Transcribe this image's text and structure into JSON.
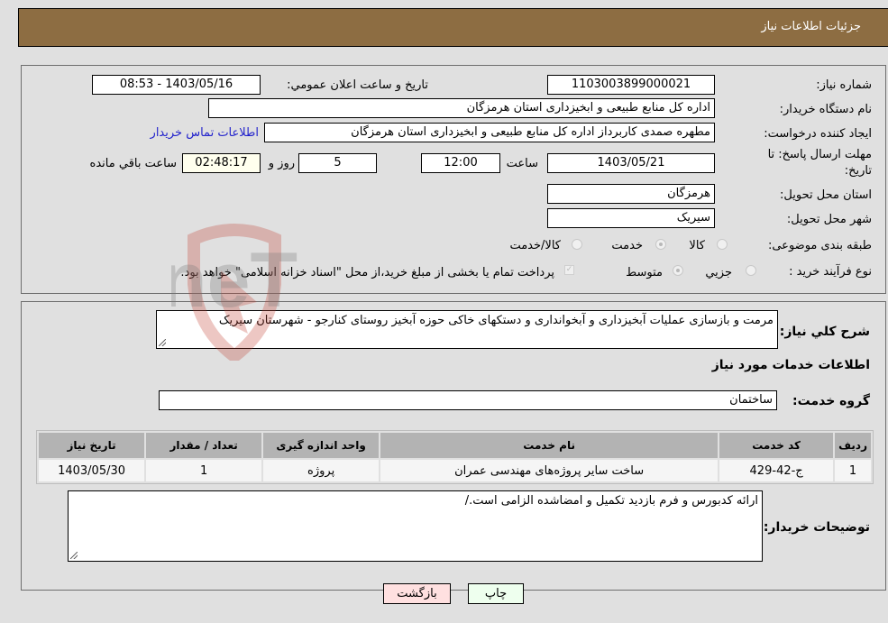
{
  "header": {
    "title": "جزئیات اطلاعات نیاز"
  },
  "form": {
    "need_number": {
      "label": "شماره نیاز:",
      "value": "1103003899000021"
    },
    "announce_datetime": {
      "label": "تاریخ و ساعت اعلان عمومي:",
      "value": "1403/05/16 - 08:53"
    },
    "buyer_org": {
      "label": "نام دستگاه خريدار:",
      "value": "اداره کل منابع طبیعی و ابخیزداری استان هرمزگان"
    },
    "requester": {
      "label": "ایجاد کننده درخواست:",
      "value": "مطهره صمدی کاربرداز اداره کل منابع طبیعی و ابخیزداری استان هرمزگان"
    },
    "buyer_contact_link": "اطلاعات تماس خریدار",
    "deadline": {
      "label_line1": "مهلت ارسال پاسخ: تا",
      "label_line2": "تاریخ:",
      "date": "1403/05/21",
      "time_label": "ساعت",
      "time": "12:00",
      "days": "5",
      "days_label": "روز و",
      "remaining": "02:48:17",
      "remaining_label": "ساعت باقي مانده"
    },
    "delivery_province": {
      "label": "استان محل تحویل:",
      "value": "هرمزگان"
    },
    "delivery_city": {
      "label": "شهر محل تحویل:",
      "value": "سیریک"
    },
    "category": {
      "label": "طبقه بندی موضوعی:",
      "options": [
        {
          "label": "کالا",
          "checked": false
        },
        {
          "label": "خدمت",
          "checked": true
        },
        {
          "label": "کالا/خدمت",
          "checked": false
        }
      ]
    },
    "purchase_type": {
      "label": "نوع فرآیند خرید :",
      "options": [
        {
          "label": "جزيي",
          "checked": false
        },
        {
          "label": "متوسط",
          "checked": true
        }
      ],
      "payment_note": "پرداخت تمام یا بخشی از مبلغ خرید،از محل \"اسناد خزانه اسلامی\" خواهد بود.",
      "payment_checked": true
    }
  },
  "details": {
    "description_label": "شرح کلي نياز:",
    "description": "مرمت و بازسازی عملیات آبخیزداری و آبخوانداری و دستکهای خاکی حوزه آبخیز روستای کنارجو - شهرستان سیریک",
    "services_heading": "اطلاعات خدمات مورد نیاز",
    "service_group_label": "گروه خدمت:",
    "service_group": "ساختمان",
    "table": {
      "headers": [
        "ردیف",
        "کد خدمت",
        "نام خدمت",
        "واحد اندازه گیری",
        "تعداد / مقدار",
        "تاریخ نیاز"
      ],
      "rows": [
        [
          "1",
          "ج-42-429",
          "ساخت سایر پروژه‌های مهندسی عمران",
          "پروژه",
          "1",
          "1403/05/30"
        ]
      ]
    },
    "buyer_notes_label": "توضیحات خریدار:",
    "buyer_notes": "ارائه کدبورس و فرم بازدید تکمیل و امضاشده الزامی است./"
  },
  "buttons": {
    "print": "چاپ",
    "back": "بازگشت"
  },
  "watermark": {
    "text": "AriaTender.neT"
  }
}
